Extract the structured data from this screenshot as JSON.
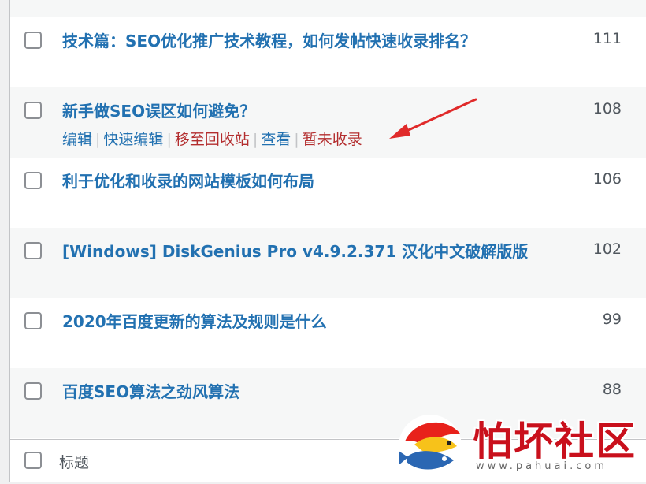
{
  "posts": [
    {
      "title": "技术篇：SEO优化推广技术教程，如何发帖快速收录排名？",
      "count": "111"
    },
    {
      "title": "新手做SEO误区如何避免？",
      "count": "108"
    },
    {
      "title": "利于优化和收录的网站模板如何布局",
      "count": "106"
    },
    {
      "title": "[Windows] DiskGenius Pro v4.9.2.371 汉化中文破解版版",
      "count": "102"
    },
    {
      "title": "2020年百度更新的算法及规则是什么",
      "count": "99"
    },
    {
      "title": "百度SEO算法之劲风算法",
      "count": "88"
    }
  ],
  "row_actions": {
    "edit": "编辑",
    "quick_edit": "快速编辑",
    "trash": "移至回收站",
    "view": "查看",
    "not_indexed": "暂未收录",
    "separator": "|"
  },
  "footer": {
    "label": "标题"
  },
  "watermark": {
    "brand": "怕坏社区",
    "url": "www.pahuai.com"
  },
  "colors": {
    "link": "#2271b1",
    "trash": "#b32d2e",
    "arrow": "#e02a2a",
    "watermark": "#c9101c"
  }
}
